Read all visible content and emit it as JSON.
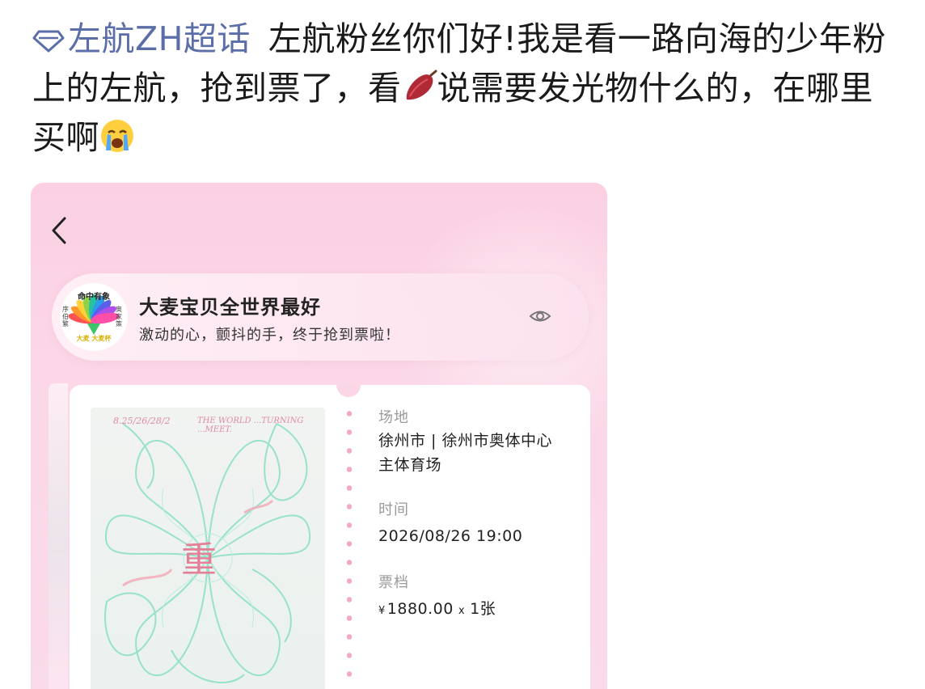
{
  "post": {
    "topic_tag": "左航ZH超话",
    "text_before_emoji": "左航粉丝你们好!我是看一路向海的少年粉上的左航，抢到票了，看",
    "emoji_1": "sweet-potato-emoji",
    "text_after_emoji": "说需要发光物什么的，在哪里买啊",
    "emoji_2": "crying-face-emoji"
  },
  "screenshot": {
    "banner": {
      "avatar_top_text": "命中有象",
      "avatar_left_text": "序\n伯\n繁",
      "avatar_right_text": "奥\n家\n策",
      "avatar_bottom_text": "大麦 大麦杯",
      "title": "大麦宝贝全世界最好",
      "subtitle": "激动的心，颤抖的手，终于抢到票啦！"
    },
    "poster": {
      "dates": "8.25/26/28/2",
      "slogan": "THE WORLD ...TURNING ...MEET.",
      "center_char": "重"
    },
    "ticket": {
      "venue_label": "场地",
      "venue_line1": "徐州市 | 徐州市奥体中心",
      "venue_line2": "主体育场",
      "time_label": "时间",
      "time_value": "2026/08/26 19:00",
      "tier_label": "票档",
      "price_symbol": "¥",
      "price_value": "1880.00",
      "qty_symbol": "x",
      "qty_value": "1张"
    }
  },
  "colors": {
    "topic_tag": "#5b6ea8",
    "pink_bg": "#fbd7e7",
    "perforation": "#f4a9c8"
  }
}
